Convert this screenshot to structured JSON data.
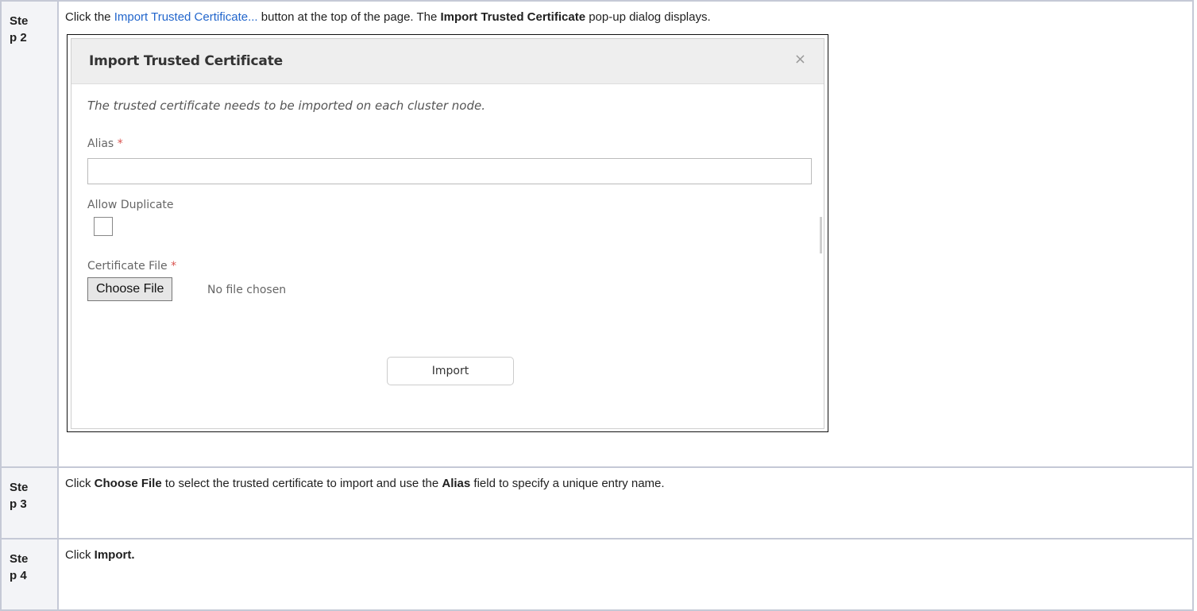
{
  "steps": [
    {
      "label": "Step 2",
      "text_parts": {
        "pre": "Click the ",
        "link": "Import Trusted Certificate...",
        "mid": " button at the top of the page. The ",
        "bold": "Import Trusted Certificate",
        "post": " pop-up dialog displays."
      }
    },
    {
      "label": "Step 3",
      "text_parts": {
        "pre": "Click ",
        "bold1": "Choose File",
        "mid": " to select the trusted certificate to import and use the ",
        "bold2": "Alias",
        "post": " field to specify a unique entry name."
      }
    },
    {
      "label": "Step 4",
      "text_parts": {
        "pre": "Click ",
        "bold": "Import."
      }
    }
  ],
  "dialog": {
    "title": "Import Trusted Certificate",
    "close_glyph": "×",
    "note": "The trusted certificate needs to be imported on each cluster node.",
    "alias_label": "Alias",
    "required_mark": "*",
    "alias_value": "",
    "allow_duplicate_label": "Allow Duplicate",
    "allow_duplicate_checked": false,
    "certificate_file_label": "Certificate File",
    "choose_file_label": "Choose File",
    "no_file_text": "No file chosen",
    "import_label": "Import"
  },
  "colors": {
    "link": "#2266cc",
    "required": "#d9534f",
    "table_border": "#c5c9d6",
    "label_background": "#f3f4f7"
  }
}
